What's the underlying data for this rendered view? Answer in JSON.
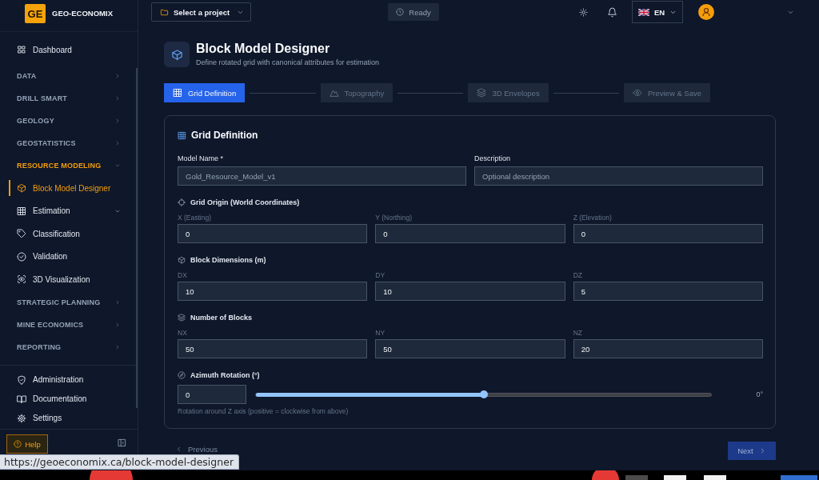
{
  "sidebar": {
    "logo": {
      "mark": "GE",
      "name": "GEO-ECONOMIX"
    },
    "nav": [
      {
        "kind": "link",
        "label": "Dashboard",
        "selected": false
      },
      {
        "kind": "section",
        "label": "DATA",
        "selected": false,
        "expanded": false
      },
      {
        "kind": "section",
        "label": "DRILL SMART",
        "selected": false,
        "expanded": false
      },
      {
        "kind": "section",
        "label": "GEOLOGY",
        "selected": false,
        "expanded": false
      },
      {
        "kind": "section",
        "label": "GEOSTATISTICS",
        "selected": false,
        "expanded": false
      },
      {
        "kind": "section",
        "label": "RESOURCE MODELING",
        "selected": true,
        "expanded": true,
        "children": [
          {
            "kind": "link",
            "label": "Block Model Designer",
            "selected": true
          },
          {
            "kind": "submenu",
            "label": "Estimation",
            "selected": false
          },
          {
            "kind": "link",
            "label": "Classification",
            "selected": false
          },
          {
            "kind": "link",
            "label": "Validation",
            "selected": false
          },
          {
            "kind": "link",
            "label": "3D Visualization",
            "selected": false
          }
        ]
      },
      {
        "kind": "section",
        "label": "STRATEGIC PLANNING",
        "selected": false,
        "expanded": false
      },
      {
        "kind": "section",
        "label": "MINE ECONOMICS",
        "selected": false,
        "expanded": false
      },
      {
        "kind": "section",
        "label": "REPORTING",
        "selected": false,
        "expanded": false
      }
    ],
    "bottom_links": [
      {
        "label": "Administration",
        "selected": false
      },
      {
        "label": "Documentation",
        "selected": false
      },
      {
        "label": "Settings",
        "selected": false
      }
    ],
    "help_button": "Help"
  },
  "topbar": {
    "project_select": "Select a project",
    "status": "Ready",
    "language": "EN"
  },
  "page": {
    "title": "Block Model Designer",
    "subtitle": "Define rotated grid with canonical attributes for estimation"
  },
  "steps": [
    {
      "label": "Grid Definition",
      "selected": true
    },
    {
      "label": "Topography",
      "selected": false
    },
    {
      "label": "3D Envelopes",
      "selected": false
    },
    {
      "label": "Preview & Save",
      "selected": false
    }
  ],
  "card": {
    "title": "Grid Definition",
    "model_name": {
      "label": "Model Name *",
      "placeholder": "Gold_Resource_Model_v1"
    },
    "description": {
      "label": "Description",
      "placeholder": "Optional description"
    },
    "groups": [
      {
        "title": "Grid Origin (World Coordinates)",
        "fields": [
          {
            "label": "X (Easting)",
            "value": "0"
          },
          {
            "label": "Y (Northing)",
            "value": "0"
          },
          {
            "label": "Z (Elevation)",
            "value": "0"
          }
        ]
      },
      {
        "title": "Block Dimensions (m)",
        "fields": [
          {
            "label": "DX",
            "value": "10"
          },
          {
            "label": "DY",
            "value": "10"
          },
          {
            "label": "DZ",
            "value": "5"
          }
        ]
      },
      {
        "title": "Number of Blocks",
        "fields": [
          {
            "label": "NX",
            "value": "50"
          },
          {
            "label": "NY",
            "value": "50"
          },
          {
            "label": "NZ",
            "value": "20"
          }
        ]
      }
    ],
    "azimuth": {
      "title": "Azimuth Rotation (°)",
      "value": "0",
      "level": 0.5,
      "reading": "0°",
      "hint": "Rotation around Z axis (positive = clockwise from above)"
    }
  },
  "actions": {
    "previous": {
      "label": "Previous",
      "disabled": true
    },
    "next": {
      "label": "Next",
      "disabled": true
    }
  },
  "status_url": "https://geoeconomix.ca/block-model-designer"
}
